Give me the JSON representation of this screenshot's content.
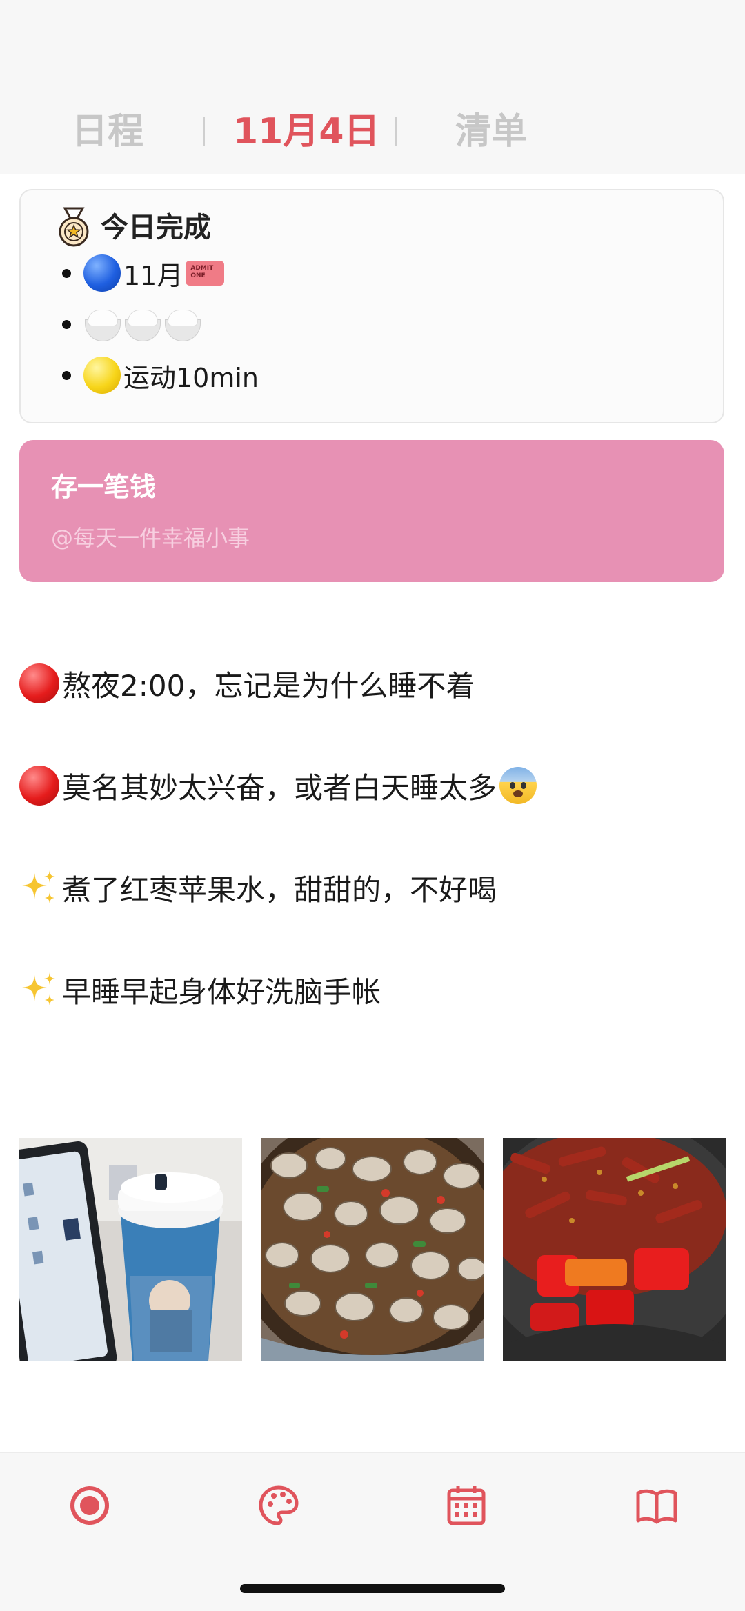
{
  "header": {
    "tabs": [
      {
        "label": "日程"
      },
      {
        "label": "11月4日"
      },
      {
        "label": "清单"
      }
    ]
  },
  "done_card": {
    "title": "今日完成",
    "items": [
      {
        "text": "11月"
      },
      {
        "text": ""
      },
      {
        "text": "运动10min"
      }
    ]
  },
  "pink_card": {
    "title": "存一笔钱",
    "subtitle": "@每天一件幸福小事"
  },
  "notes": [
    {
      "marker": "red-circle",
      "text": "熬夜2:00，忘记是为什么睡不着"
    },
    {
      "marker": "red-circle",
      "text": "莫名其妙太兴奋，或者白天睡太多"
    },
    {
      "marker": "sparkles",
      "text": "煮了红枣苹果水，甜甜的，不好喝"
    },
    {
      "marker": "sparkles",
      "text": "早睡早起身体好洗脑手帐"
    }
  ],
  "photos": [
    {
      "name": "photo-tablet-and-drink"
    },
    {
      "name": "photo-clams-dish"
    },
    {
      "name": "photo-chili-wok"
    }
  ],
  "bottom_nav": {
    "icons": [
      "record-icon",
      "palette-icon",
      "calendar-icon",
      "book-icon"
    ]
  },
  "colors": {
    "accent": "#e0545c",
    "pink_card": "#e791b4",
    "inactive_tab": "#c7c7c7"
  }
}
